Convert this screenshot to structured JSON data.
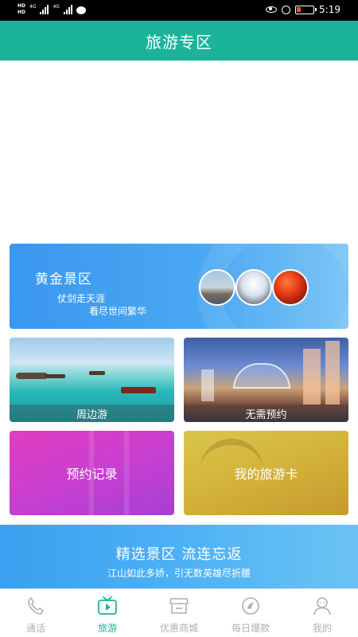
{
  "status_bar": {
    "hd1": "HD",
    "hd2": "HD",
    "net1": "4G",
    "net2": "4G",
    "time": "5:19"
  },
  "header": {
    "title": "旅游专区"
  },
  "golden_area": {
    "title": "黄金景区",
    "line1": "仗剑走天涯",
    "line2": "看尽世间繁华"
  },
  "tiles": {
    "nearby": "周边游",
    "no_booking": "无需预约",
    "booking_records": "预约记录",
    "my_travel_card": "我的旅游卡"
  },
  "banner": {
    "title": "精选景区 流连忘返",
    "subtitle": "江山如此多娇，引无数英雄尽折腰"
  },
  "nav": {
    "items": [
      {
        "label": "通话",
        "icon": "phone-icon"
      },
      {
        "label": "旅游",
        "icon": "tv-play-icon"
      },
      {
        "label": "优惠商城",
        "icon": "store-icon"
      },
      {
        "label": "每日爆款",
        "icon": "hot-deal-icon"
      },
      {
        "label": "我的",
        "icon": "user-icon"
      }
    ],
    "active_index": 1
  },
  "colors": {
    "accent": "#1bb49a",
    "inactive": "#b0b0b0"
  }
}
